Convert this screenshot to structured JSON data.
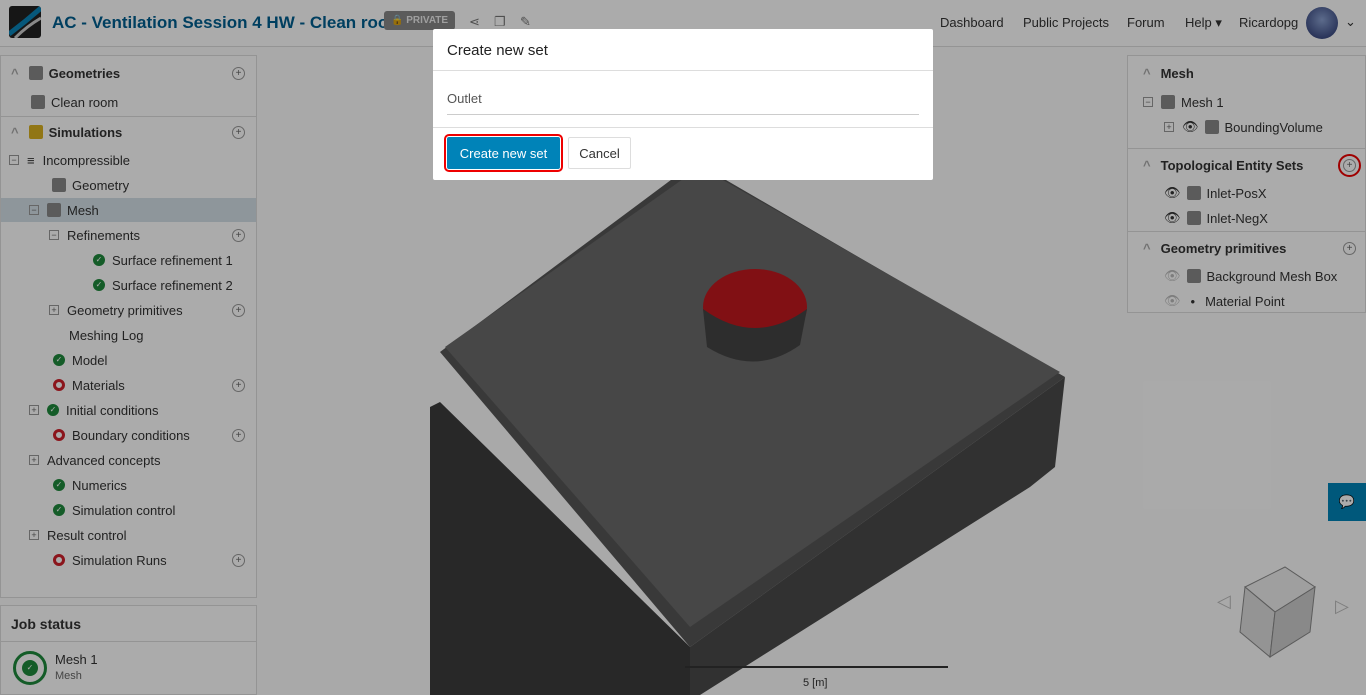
{
  "header": {
    "title": "AC - Ventilation Session 4 HW - Clean room",
    "badge": "PRIVATE",
    "nav": [
      "Dashboard",
      "Public Projects",
      "Forum",
      "Help",
      "Ricardopg"
    ]
  },
  "left_tree": {
    "geometries": "Geometries",
    "clean_room": "Clean room",
    "simulations": "Simulations",
    "items": [
      "Incompressible",
      "Geometry",
      "Mesh",
      "Refinements",
      "Surface refinement 1",
      "Surface refinement 2",
      "Geometry primitives",
      "Meshing Log",
      "Model",
      "Materials",
      "Initial conditions",
      "Boundary conditions",
      "Advanced concepts",
      "Numerics",
      "Simulation control",
      "Result control",
      "Simulation Runs"
    ]
  },
  "job_status": {
    "title": "Job status",
    "name": "Mesh 1",
    "type": "Mesh"
  },
  "right_panel": {
    "mesh": "Mesh",
    "mesh1": "Mesh 1",
    "bounding": "BoundingVolume",
    "tes": "Topological Entity Sets",
    "sets": [
      "Inlet-PosX",
      "Inlet-NegX"
    ],
    "gp": "Geometry primitives",
    "prims": [
      "Background Mesh Box",
      "Material Point"
    ]
  },
  "scale": "5 [m]",
  "modal": {
    "title": "Create new set",
    "value": "Outlet",
    "create": "Create new set",
    "cancel": "Cancel"
  }
}
